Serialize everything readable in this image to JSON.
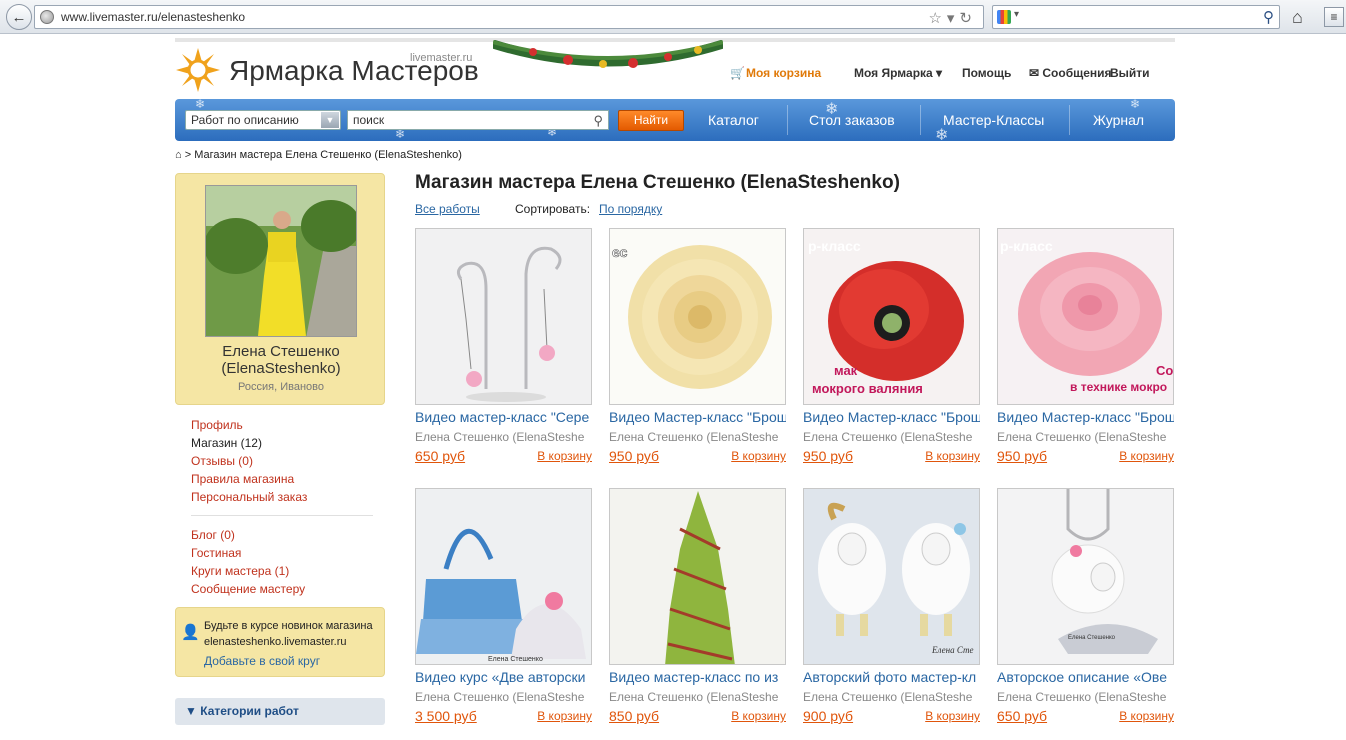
{
  "browser": {
    "url": "www.livemaster.ru/elenasteshenko",
    "google_placeholder": ""
  },
  "header": {
    "logo_text": "Ярмарка Мастеров",
    "logo_domain": "livemaster.ru",
    "cart": "Моя корзина",
    "my_fair": "Моя Ярмарка",
    "help": "Помощь",
    "messages": "Сообщения",
    "exit": "Выйти"
  },
  "nav": {
    "select_value": "Работ по описанию",
    "search_value": "поиск",
    "find_button": "Найти",
    "items": [
      "Каталог",
      "Стол заказов",
      "Мастер-Классы",
      "Журнал"
    ]
  },
  "breadcrumb": "> Магазин мастера Елена Стешенко (ElenaSteshenko)",
  "profile": {
    "name": "Елена Стешенко",
    "username": "(ElenaSteshenko)",
    "location": "Россия, Иваново"
  },
  "sidebar": {
    "links1": [
      "Профиль",
      "Магазин (12)",
      "Отзывы (0)",
      "Правила магазина",
      "Персональный заказ"
    ],
    "links2": [
      "Блог (0)",
      "Гостиная",
      "Круги мастера (1)",
      "Сообщение мастеру"
    ],
    "subscribe_line1": "Будьте в курсе новинок магазина",
    "subscribe_line2": "elenasteshenko.livemaster.ru",
    "subscribe_link": "Добавьте в свой круг",
    "categories": "Категории работ"
  },
  "main": {
    "title": "Магазин мастера Елена Стешенко (ElenaSteshenko)",
    "all_works": "Все работы",
    "sort_label": "Сортировать:",
    "sort_value": "По порядку",
    "cards": [
      {
        "title": "Видео мастер-класс \"Сере",
        "author": "Елена Стешенко (ElenaSteshe",
        "price": "650 руб",
        "cart": "В корзину"
      },
      {
        "title": "Видео Мастер-класс \"Брош",
        "author": "Елена Стешенко (ElenaSteshe",
        "price": "950 руб",
        "cart": "В корзину"
      },
      {
        "title": "Видео Мастер-класс \"Брош",
        "author": "Елена Стешенко (ElenaSteshe",
        "price": "950 руб",
        "cart": "В корзину"
      },
      {
        "title": "Видео Мастер-класс \"Брош",
        "author": "Елена Стешенко (ElenaSteshe",
        "price": "950 руб",
        "cart": "В корзину"
      },
      {
        "title": "Видео курс «Две авторски",
        "author": "Елена Стешенко (ElenaSteshe",
        "price": "3 500 руб",
        "cart": "В корзину"
      },
      {
        "title": "Видео мастер-класс по из",
        "author": "Елена Стешенко (ElenaSteshe",
        "price": "850 руб",
        "cart": "В корзину"
      },
      {
        "title": "Авторский фото мастер-кл",
        "author": "Елена Стешенко (ElenaSteshe",
        "price": "900 руб",
        "cart": "В корзину"
      },
      {
        "title": "Авторское описание «Ове",
        "author": "Елена Стешенко (ElenaSteshe",
        "price": "650 руб",
        "cart": "В корзину"
      }
    ],
    "thumb_labels": {
      "flower2": "ес",
      "poppy_top": "р-класс",
      "poppy_bottom1": "мак",
      "poppy_bottom2": "мокрого валяния",
      "rose_top": "р-класс",
      "rose_bottom1": "Со",
      "rose_bottom2": "в технике мокро",
      "bag_sig": "Елена Стешенко",
      "sheep_sig": "Елена Сте"
    }
  }
}
